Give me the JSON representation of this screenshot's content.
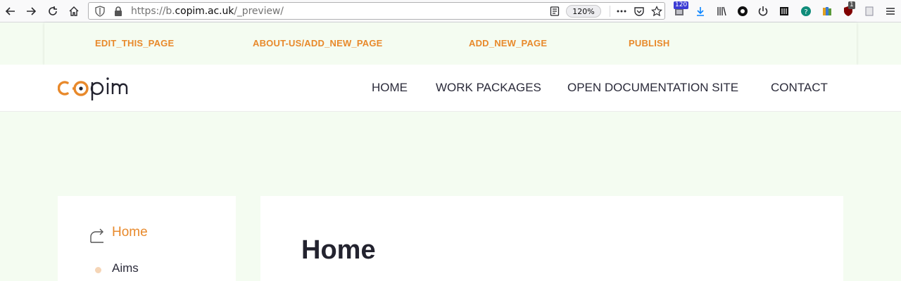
{
  "browser": {
    "url_prefix": "https://b.",
    "url_host": "copim.ac.uk",
    "url_path": "/_preview/",
    "zoom": "120%",
    "badges": {
      "ext_count": "120",
      "ublock_count": "1"
    }
  },
  "adminbar": {
    "links": [
      "EDIT_THIS_PAGE",
      "ABOUT-US/ADD_NEW_PAGE",
      "ADD_NEW_PAGE",
      "PUBLISH"
    ]
  },
  "site": {
    "logo_text": "copim",
    "nav": [
      "HOME",
      "WORK PACKAGES",
      "OPEN DOCUMENTATION SITE",
      "CONTACT"
    ]
  },
  "sidebar": {
    "home": "Home",
    "items": [
      "Aims"
    ]
  },
  "main": {
    "title": "Home"
  },
  "colors": {
    "accent": "#e8892b",
    "page_bg": "#f4fcf1",
    "text": "#2b2b3a"
  }
}
